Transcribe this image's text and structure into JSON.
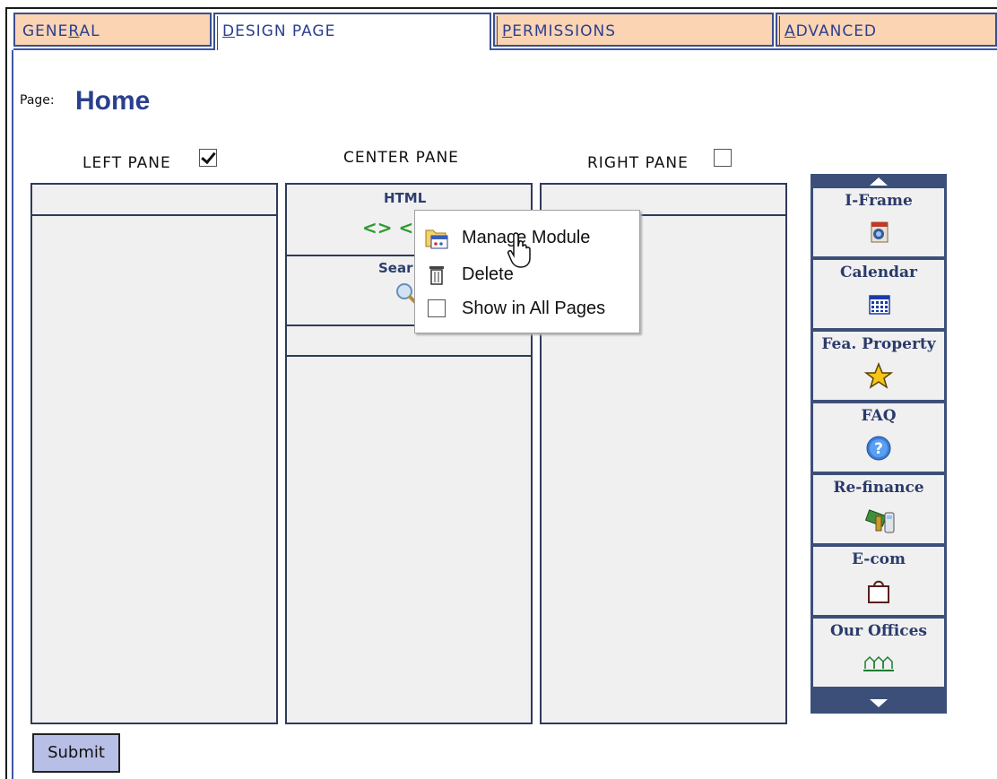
{
  "tabs": [
    {
      "label_pre": "GENE",
      "label_u": "R",
      "label_post": "AL"
    },
    {
      "label_pre": "",
      "label_u": "D",
      "label_post": "ESIGN PAGE"
    },
    {
      "label_pre": "",
      "label_u": "P",
      "label_post": "ERMISSIONS"
    },
    {
      "label_pre": "",
      "label_u": "A",
      "label_post": "DVANCED"
    }
  ],
  "active_tab": "DESIGN PAGE",
  "page": {
    "label": "Page:",
    "name": "Home"
  },
  "panes": {
    "left": {
      "title": "LEFT PANE",
      "checked": true
    },
    "center": {
      "title": "CENTER PANE"
    },
    "right": {
      "title": "RIGHT PANE",
      "checked": false
    }
  },
  "center_modules": [
    {
      "title": "HTML",
      "icon": "code-icon",
      "icon_text": "<> <"
    },
    {
      "title": "Sear",
      "icon": "magnifier-icon"
    }
  ],
  "context_menu": {
    "items": [
      {
        "label": "Manage Module",
        "icon": "manage-module-icon"
      },
      {
        "label": "Delete",
        "icon": "trash-icon"
      },
      {
        "label": "Show in All Pages",
        "icon": "checkbox-icon"
      }
    ]
  },
  "palette": {
    "items": [
      {
        "label": "I-Frame",
        "icon": "iframe-icon"
      },
      {
        "label": "Calendar",
        "icon": "calendar-icon"
      },
      {
        "label": "Fea. Property",
        "icon": "star-icon"
      },
      {
        "label": "FAQ",
        "icon": "help-icon"
      },
      {
        "label": "Re-finance",
        "icon": "money-calculator-icon"
      },
      {
        "label": "E-com",
        "icon": "shopping-bag-icon"
      },
      {
        "label": "Our Offices",
        "icon": "houses-icon"
      }
    ]
  },
  "submit_label": "Submit",
  "colors": {
    "tab_bg": "#fbd4b4",
    "accent": "#2b3f8f",
    "palette_bg": "#3b4f79",
    "pane_border": "#2e3b5a"
  }
}
